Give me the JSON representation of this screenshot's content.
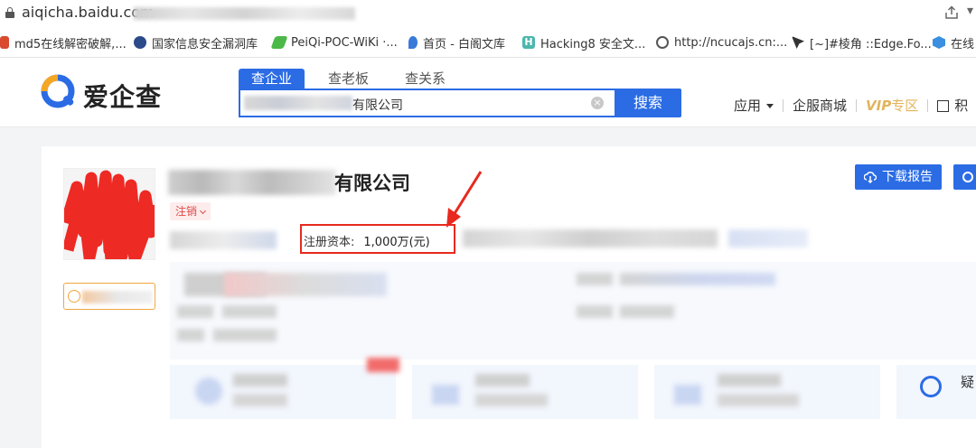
{
  "browser": {
    "url": "aiqicha.baidu.com"
  },
  "bookmarks": [
    {
      "label": "md5在线解密破解,...",
      "icon": "md5-icon",
      "color": "#d94a2f"
    },
    {
      "label": "国家信息安全漏洞库",
      "icon": "cnnvd-icon",
      "color": "#2a4a8a"
    },
    {
      "label": "PeiQi-POC-WiKi ·...",
      "icon": "peiqi-icon",
      "color": "#4cb848"
    },
    {
      "label": "首页 - 白阁文库",
      "icon": "baige-icon",
      "color": "#3a7ad9"
    },
    {
      "label": "Hacking8 安全文...",
      "icon": "hacking8-icon",
      "color": "#4db6ac"
    },
    {
      "label": "http://ncucajs.cn:...",
      "icon": "globe-icon",
      "color": "#555555"
    },
    {
      "label": "[~]#棱角 ::Edge.Fo...",
      "icon": "edge-icon",
      "color": "#333333"
    },
    {
      "label": "在线",
      "icon": "hex-icon",
      "color": "#3a8fe0"
    }
  ],
  "site": {
    "logo_text": "爱企查",
    "tabs": [
      {
        "label": "查企业",
        "active": true
      },
      {
        "label": "查老板",
        "active": false
      },
      {
        "label": "查关系",
        "active": false
      }
    ],
    "search": {
      "value_suffix": "有限公司",
      "button_label": "搜索"
    },
    "nav": {
      "apps": "应用",
      "services": "企服商城",
      "vip": "VIP",
      "vip_zone": "专区",
      "points": "积"
    }
  },
  "company": {
    "name_suffix": "有限公司",
    "status": "注销",
    "registered_capital_label": "注册资本:",
    "registered_capital_value": "1,000万(元)",
    "download_label": "下载报告"
  },
  "bottom": {
    "cut_text": "疑"
  },
  "colors": {
    "brand_blue": "#2b6ce5",
    "annotation_red": "#e8291f",
    "status_red": "#e04a4a"
  }
}
